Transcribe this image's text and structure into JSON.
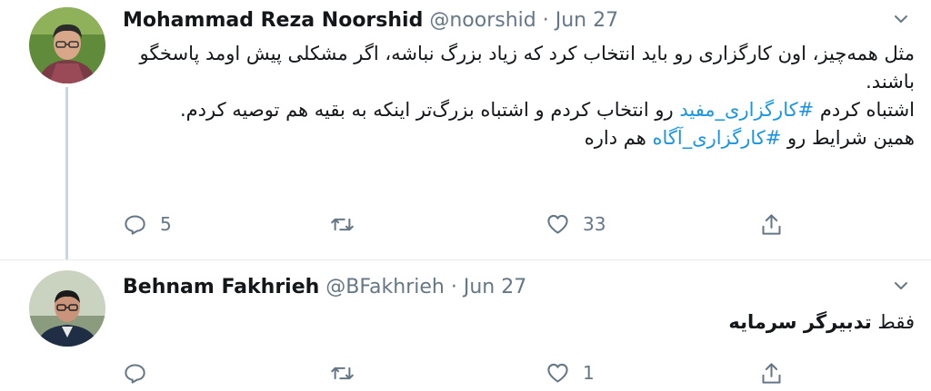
{
  "tweets": [
    {
      "name": "Mohammad Reza Noorshid",
      "handle": "@noorshid",
      "separator": "·",
      "date": "Jun 27",
      "lines": [
        [
          "مثل همه‌چیز، اون کارگزاری رو باید انتخاب کرد که زیاد بزرگ نباشه، اگر مشکلی پیش اومد پاسخگو باشند."
        ],
        [
          "اشتباه کردم ",
          "#کارگزاری_مفید",
          " رو انتخاب کردم و اشتباه بزرگ‌تر اینکه به بقیه هم توصیه کردم."
        ],
        [
          "همین شرایط رو ",
          "#کارگزاری_آگاه",
          " هم داره"
        ]
      ],
      "reply_count": "5",
      "retweet_count": "",
      "like_count": "33"
    },
    {
      "name": "Behnam Fakhrieh",
      "handle": "@BFakhrieh",
      "separator": "·",
      "date": "Jun 27",
      "text_plain": "فقط ",
      "text_bold": "تدبیرگر سرمایه",
      "reply_count": "",
      "retweet_count": "",
      "like_count": "1"
    }
  ],
  "colors": {
    "hashtag": "#1b95e0",
    "meta": "#657786",
    "divider": "#e6ecf0",
    "thread_line": "#ccd6dd"
  }
}
